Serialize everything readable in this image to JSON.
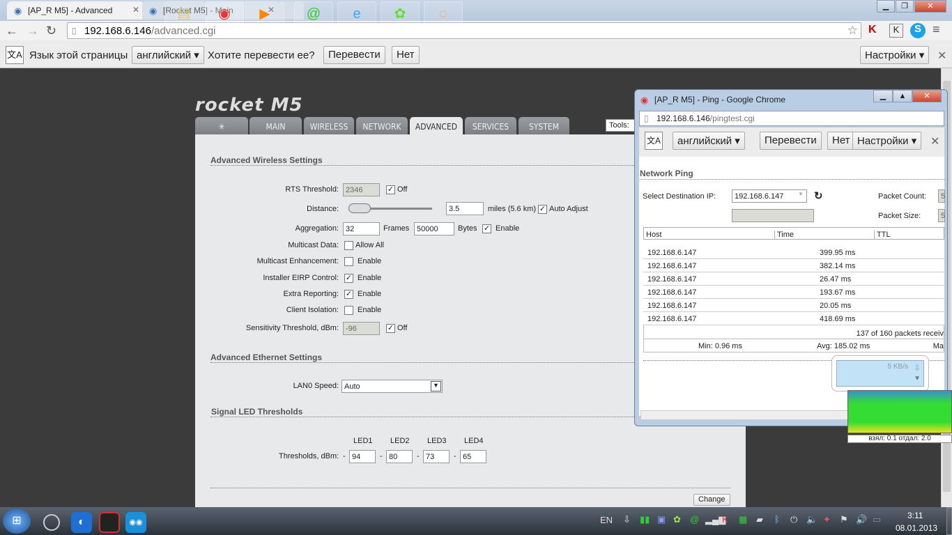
{
  "browser": {
    "tabs": [
      {
        "title": "[AP_R M5] - Advanced"
      },
      {
        "title": "[Rocket M5] - Main"
      }
    ],
    "url_host": "192.168.6.146",
    "url_path": "/advanced.cgi"
  },
  "translate": {
    "lang_label": "Язык этой страницы",
    "lang": "английский",
    "question": "Хотите перевести ее?",
    "translate_btn": "Перевести",
    "no_btn": "Нет",
    "settings_btn": "Настройки"
  },
  "device": {
    "logo": "rocket M5",
    "nav": [
      "MAIN",
      "WIRELESS",
      "NETWORK",
      "ADVANCED",
      "SERVICES",
      "SYSTEM"
    ],
    "tools_label": "Tools:"
  },
  "wireless": {
    "title": "Advanced Wireless Settings",
    "rts_label": "RTS Threshold:",
    "rts_value": "2346",
    "rts_off": "Off",
    "distance_label": "Distance:",
    "distance_value": "3.5",
    "distance_unit": "miles (5.6 km)",
    "auto_adjust": "Auto Adjust",
    "aggregation_label": "Aggregation:",
    "agg_frames": "32",
    "frames_label": "Frames",
    "agg_bytes": "50000",
    "bytes_label": "Bytes",
    "agg_enable": "Enable",
    "multicast_label": "Multicast Data:",
    "multicast_opt": "Allow All",
    "mc_enh_label": "Multicast Enhancement:",
    "mc_enh_opt": "Enable",
    "eirp_label": "Installer EIRP Control:",
    "eirp_opt": "Enable",
    "extra_label": "Extra Reporting:",
    "extra_opt": "Enable",
    "iso_label": "Client Isolation:",
    "iso_opt": "Enable",
    "sens_label": "Sensitivity Threshold, dBm:",
    "sens_value": "-96",
    "sens_off": "Off"
  },
  "ethernet": {
    "title": "Advanced Ethernet Settings",
    "lan_label": "LAN0 Speed:",
    "lan_value": "Auto"
  },
  "led": {
    "title": "Signal LED Thresholds",
    "heads": [
      "LED1",
      "LED2",
      "LED3",
      "LED4"
    ],
    "label": "Thresholds, dBm:",
    "values": [
      "94",
      "80",
      "73",
      "65"
    ],
    "dash": "-"
  },
  "change_btn": "Change",
  "popup": {
    "title": "[AP_R M5] - Ping - Google Chrome",
    "url_host": "192.168.6.146",
    "url_path": "/pingtest.cgi",
    "lang": "английский",
    "translate_btn": "Перевести",
    "no_btn": "Нет",
    "settings_btn": "Настройки",
    "section": "Network Ping",
    "dest_label": "Select Destination IP:",
    "dest_value": "192.168.6.147",
    "count_label": "Packet Count:",
    "size_label": "Packet Size:",
    "count_value": "5",
    "size_value": "5",
    "cols": [
      "Host",
      "Time",
      "TTL"
    ],
    "rows": [
      {
        "host": "192.168.6.147",
        "time": "399.95 ms"
      },
      {
        "host": "192.168.6.147",
        "time": "382.14 ms"
      },
      {
        "host": "192.168.6.147",
        "time": "26.47 ms"
      },
      {
        "host": "192.168.6.147",
        "time": "193.67 ms"
      },
      {
        "host": "192.168.6.147",
        "time": "20.05 ms"
      },
      {
        "host": "192.168.6.147",
        "time": "418.69 ms"
      }
    ],
    "received": "137 of 160 packets receiv",
    "min": "Min: 0.96 ms",
    "avg": "Avg: 185.02 ms",
    "max": "Ma"
  },
  "netmon": {
    "speed": "5 KB/s",
    "stats": "взял: 0.1 отдал: 2.0"
  },
  "tray": {
    "lang": "EN",
    "time": "3:11",
    "date": "08.01.2013"
  }
}
